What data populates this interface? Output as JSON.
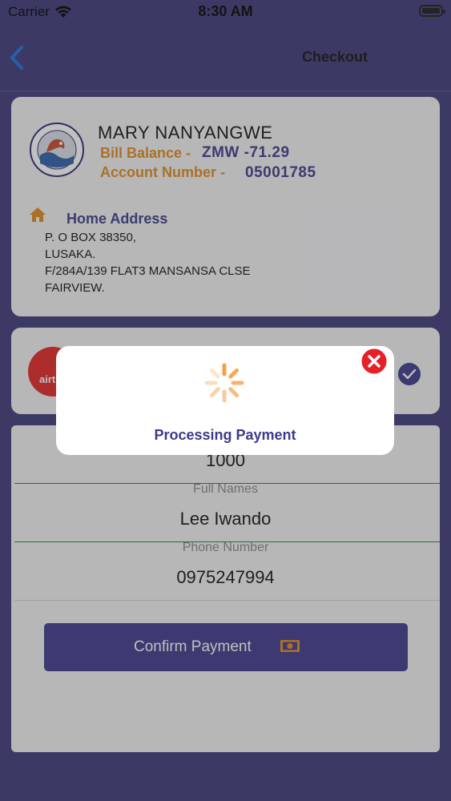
{
  "status_bar": {
    "carrier": "Carrier",
    "time": "8:30 AM"
  },
  "nav": {
    "title": "Checkout"
  },
  "customer": {
    "name": "MARY NANYANGWE",
    "balance_label": "Bill Balance -",
    "balance_value": "ZMW -71.29",
    "account_label": "Account Number -",
    "account_value": "05001785"
  },
  "address": {
    "title": "Home Address",
    "lines": [
      "P. O BOX 38350,",
      "LUSAKA.",
      "F/284A/139 FLAT3 MANSANSA CLSE",
      "FAIRVIEW."
    ]
  },
  "payment_method": {
    "logo_text": "airt",
    "selected": true
  },
  "form": {
    "amount_value": "1000",
    "full_names_label": "Full Names",
    "full_names_value": "Lee Iwando",
    "phone_label": "Phone Number",
    "phone_value": "0975247994",
    "confirm_label": "Confirm Payment"
  },
  "modal": {
    "message": "Processing Payment"
  },
  "colors": {
    "primary": "#3d3a8a",
    "accent_orange": "#e08a1e",
    "close_red": "#e52127",
    "airtel_red": "#e32526",
    "spinner_orange": "#f5a04a"
  }
}
